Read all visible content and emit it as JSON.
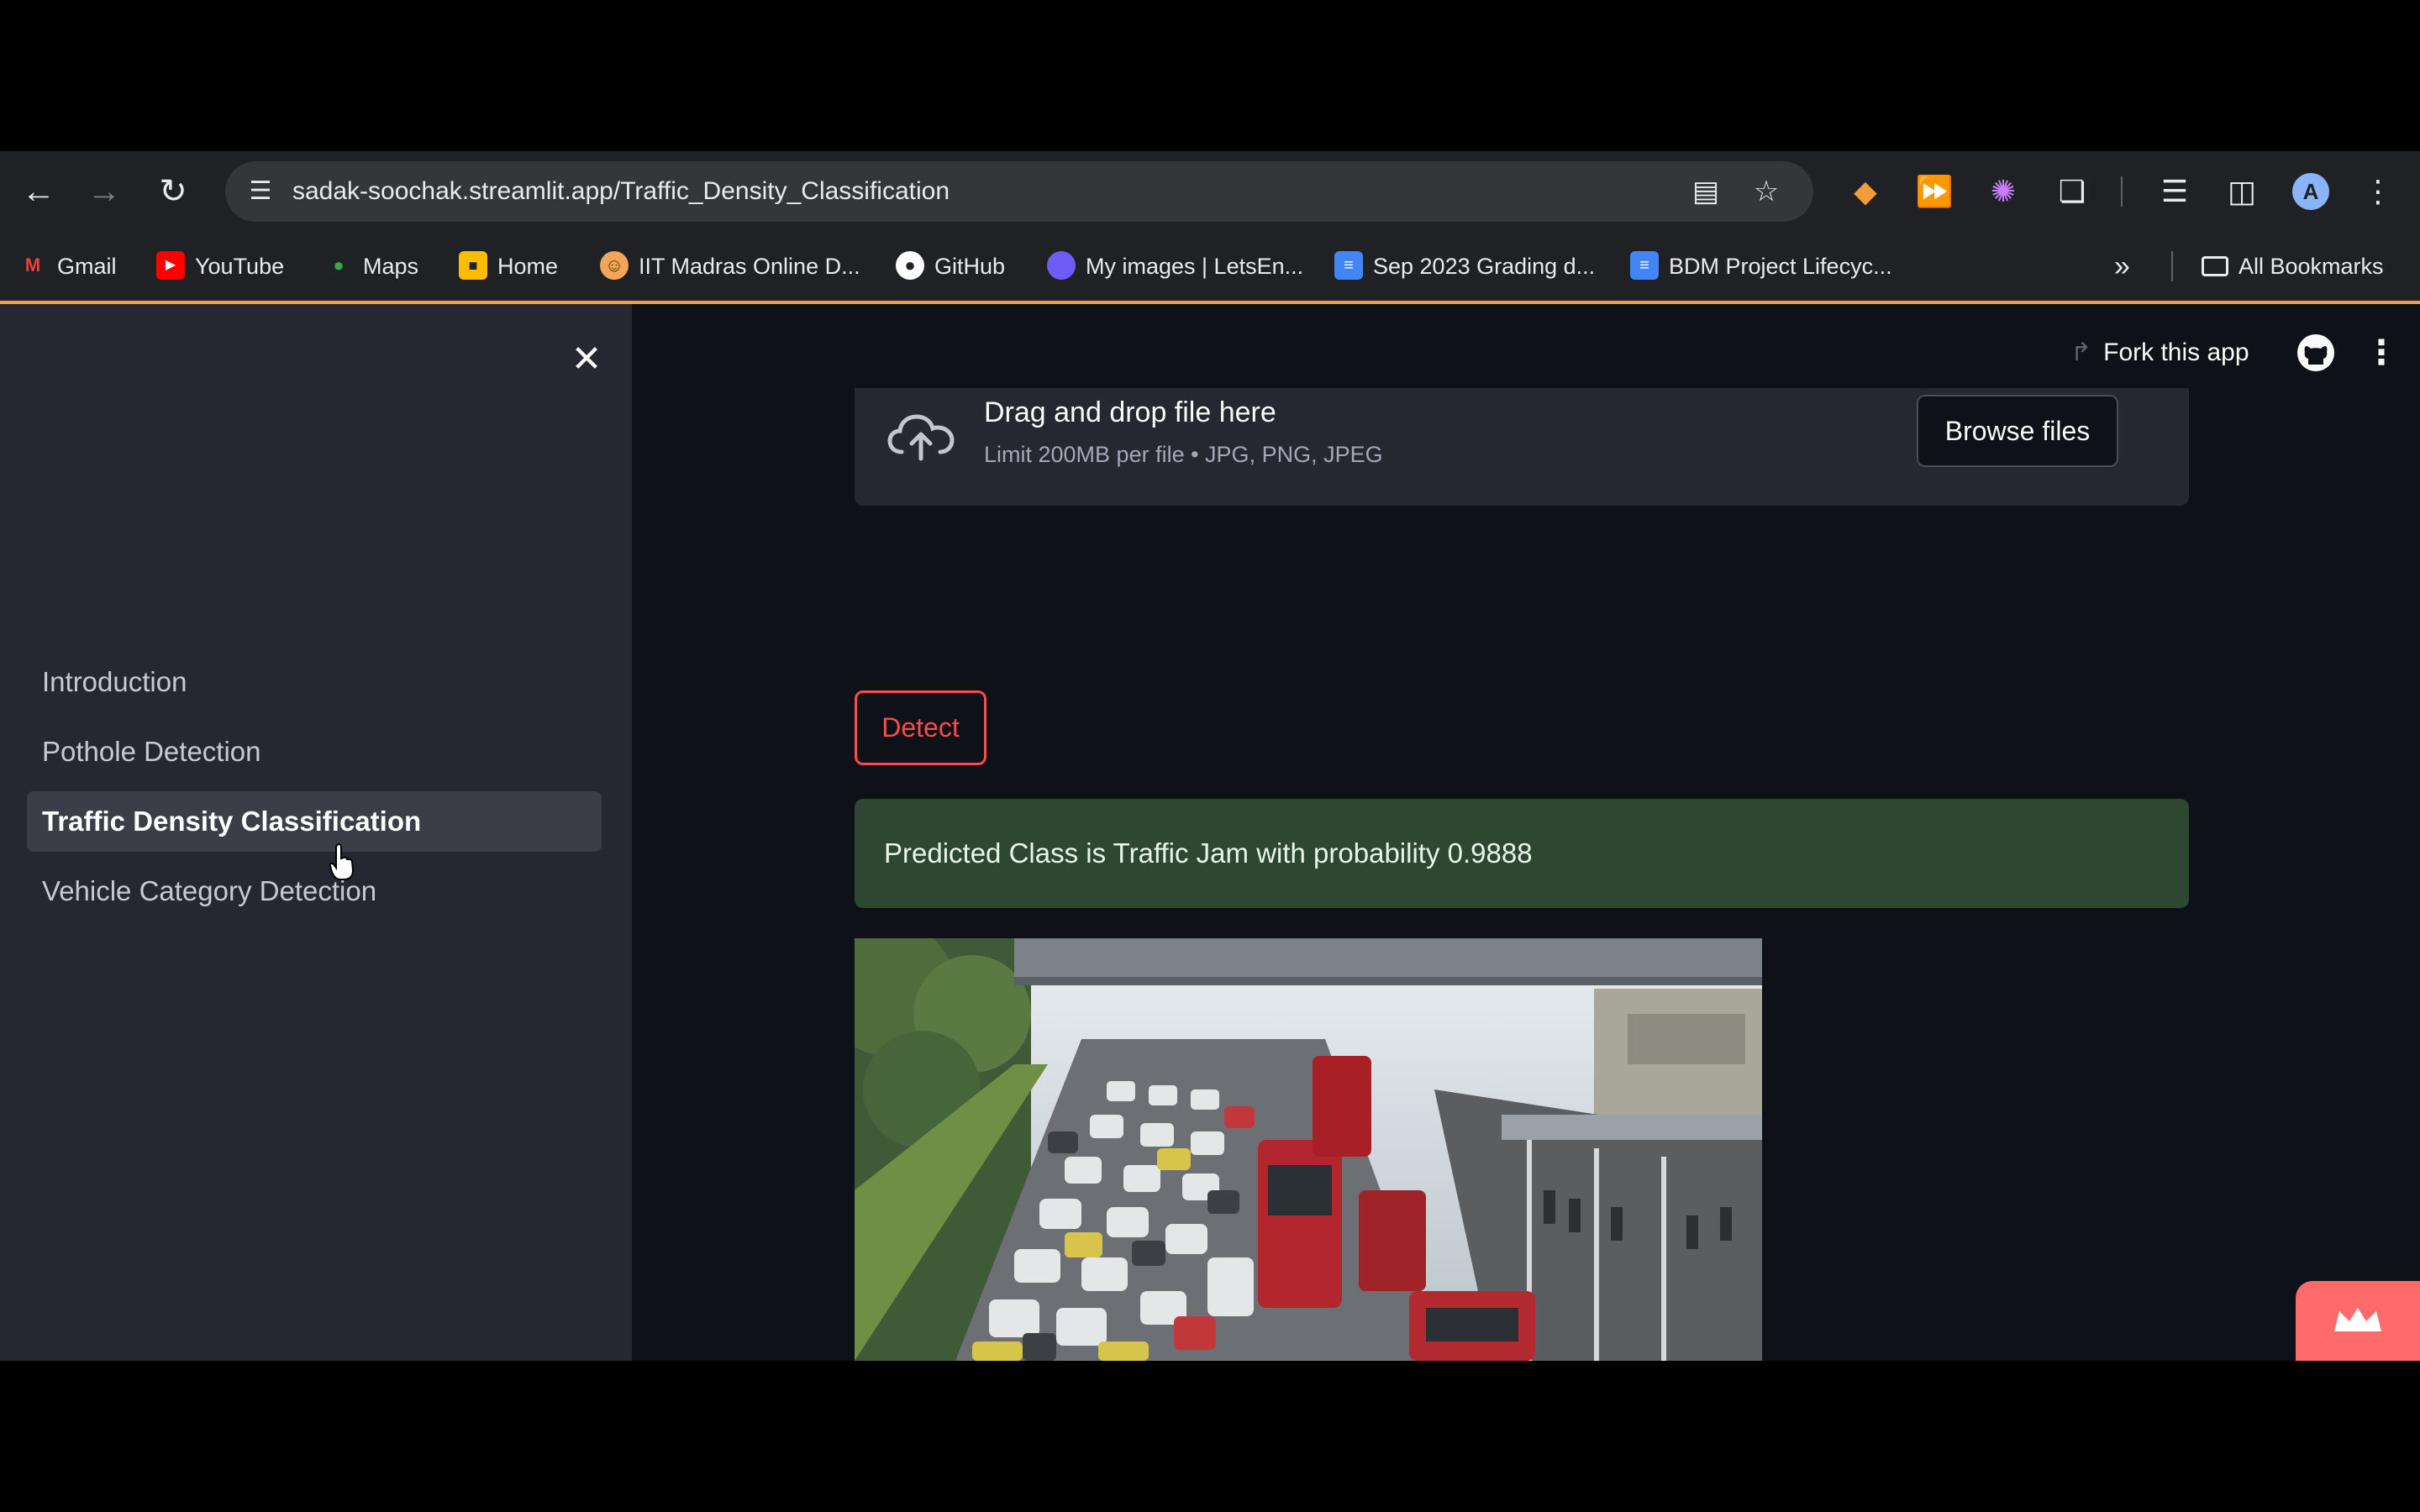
{
  "browser": {
    "url": "sadak-soochak.streamlit.app/Traffic_Density_Classification",
    "avatar_letter": "A",
    "bookmarks": [
      {
        "label": "Gmail",
        "icon": "gmail-icon",
        "color": "#ea4335"
      },
      {
        "label": "YouTube",
        "icon": "youtube-icon",
        "color": "#ff0000"
      },
      {
        "label": "Maps",
        "icon": "maps-pin-icon",
        "color": "#34a853"
      },
      {
        "label": "Home",
        "icon": "home-icon",
        "color": "#fbbc04"
      },
      {
        "label": "IIT Madras Online D...",
        "icon": "iitm-icon",
        "color": "#f2a65a"
      },
      {
        "label": "GitHub",
        "icon": "github-icon",
        "color": "#ffffff"
      },
      {
        "label": "My images | LetsEn...",
        "icon": "letsenhance-icon",
        "color": "#6f5cf6"
      },
      {
        "label": "Sep 2023 Grading d...",
        "icon": "docs-icon",
        "color": "#4285f4"
      },
      {
        "label": "BDM Project Lifecyc...",
        "icon": "docs-icon",
        "color": "#4285f4"
      }
    ],
    "all_bookmarks": "All Bookmarks"
  },
  "sidebar": {
    "items": [
      {
        "label": "Introduction"
      },
      {
        "label": "Pothole Detection"
      },
      {
        "label": "Traffic Density Classification",
        "active": true
      },
      {
        "label": "Vehicle Category Detection"
      }
    ]
  },
  "header": {
    "fork_label": "Fork this app"
  },
  "uploader": {
    "title": "Drag and drop file here",
    "limit": "Limit 200MB per file • JPG, PNG, JPEG",
    "browse_label": "Browse files"
  },
  "detect_label": "Detect",
  "result": {
    "message": "Predicted Class is Traffic Jam with probability 0.9888"
  },
  "colors": {
    "primary": "#ff4b4b",
    "success_bg": "#2e4731",
    "sidebar_bg": "#262730",
    "app_bg": "#0e1117"
  }
}
